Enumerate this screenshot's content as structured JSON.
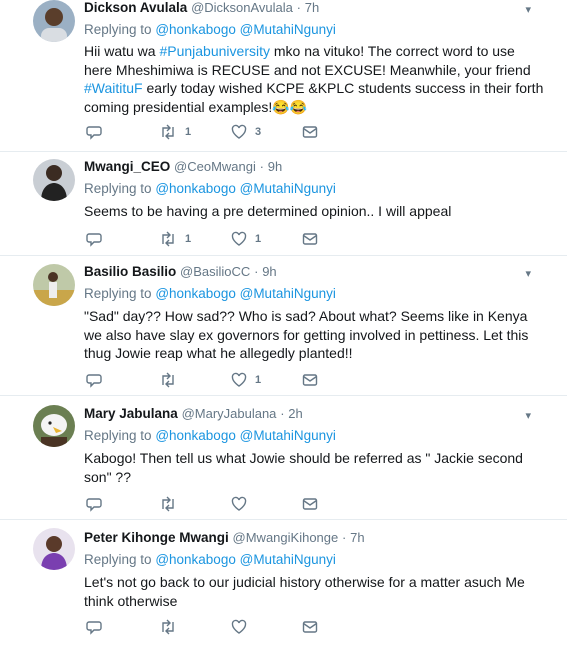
{
  "caret": "▾",
  "tweets": [
    {
      "name": "Dickson Avulala",
      "handle": "@DicksonAvulala",
      "dot": "·",
      "time": "7h",
      "replying_prefix": "Replying to",
      "mention1": "@honkabogo",
      "mention2": "@MutahiNgunyi",
      "text": [
        {
          "t": "Hii watu wa ",
          "h": false
        },
        {
          "t": "#Punjabuniversity",
          "h": true
        },
        {
          "t": " mko na vituko! The correct word to use here Mheshimiwa is RECUSE and not EXCUSE! Meanwhile, your friend ",
          "h": false
        },
        {
          "t": "#WaitituF",
          "h": true
        },
        {
          "t": " early today wished KCPE &KPLC students success in their forth coming presidential examples!😂😂",
          "h": false
        }
      ],
      "retweets": "1",
      "likes": "3"
    },
    {
      "name": "Mwangi_CEO",
      "handle": "@CeoMwangi",
      "dot": "·",
      "time": "9h",
      "replying_prefix": "Replying to",
      "mention1": "@honkabogo",
      "mention2": "@MutahiNgunyi",
      "text": [
        {
          "t": "Seems to be having a pre determined opinion.. I will appeal",
          "h": false
        }
      ],
      "retweets": "1",
      "likes": "1"
    },
    {
      "name": "Basilio Basilio",
      "handle": "@BasilioCC",
      "dot": "·",
      "time": "9h",
      "replying_prefix": "Replying to",
      "mention1": "@honkabogo",
      "mention2": "@MutahiNgunyi",
      "text": [
        {
          "t": "\"Sad\" day?? How sad?? Who is sad? About what? Seems like in Kenya we also have slay ex governors for getting involved in pettiness. Let this thug Jowie reap what he allegedly planted!!",
          "h": false
        }
      ],
      "retweets": "",
      "likes": "1"
    },
    {
      "name": "Mary Jabulana",
      "handle": "@MaryJabulana",
      "dot": "·",
      "time": "2h",
      "replying_prefix": "Replying to",
      "mention1": "@honkabogo",
      "mention2": "@MutahiNgunyi",
      "text": [
        {
          "t": "Kabogo! Then tell us what Jowie should be referred as \" Jackie second son\" ??",
          "h": false
        }
      ],
      "retweets": "",
      "likes": ""
    },
    {
      "name": "Peter Kihonge Mwangi",
      "handle": "@MwangiKihonge",
      "dot": "·",
      "time": "7h",
      "replying_prefix": "Replying to",
      "mention1": "@honkabogo",
      "mention2": "@MutahiNgunyi",
      "text": [
        {
          "t": "Let's not go back to our judicial history  otherwise for a matter asuch Me think otherwise",
          "h": false
        }
      ],
      "retweets": "",
      "likes": ""
    }
  ]
}
